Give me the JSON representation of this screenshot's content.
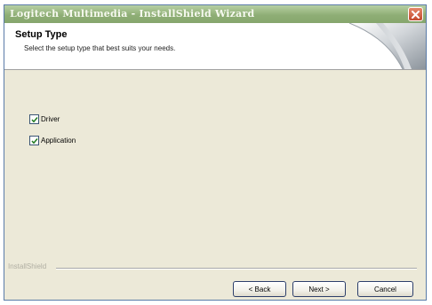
{
  "window": {
    "title": "Logitech Multimedia - InstallShield Wizard",
    "close_icon": "close-icon"
  },
  "header": {
    "title": "Setup Type",
    "subtitle": "Select the setup type that best suits your needs."
  },
  "options": [
    {
      "label": "Driver",
      "checked": true
    },
    {
      "label": "Application",
      "checked": true
    }
  ],
  "footer": {
    "brand": "InstallShield",
    "back_label": "< Back",
    "next_label": "Next >",
    "cancel_label": "Cancel"
  },
  "colors": {
    "titlebar": "#8fae76",
    "dialog_bg": "#ece9d8",
    "close_button": "#c34a2e"
  }
}
